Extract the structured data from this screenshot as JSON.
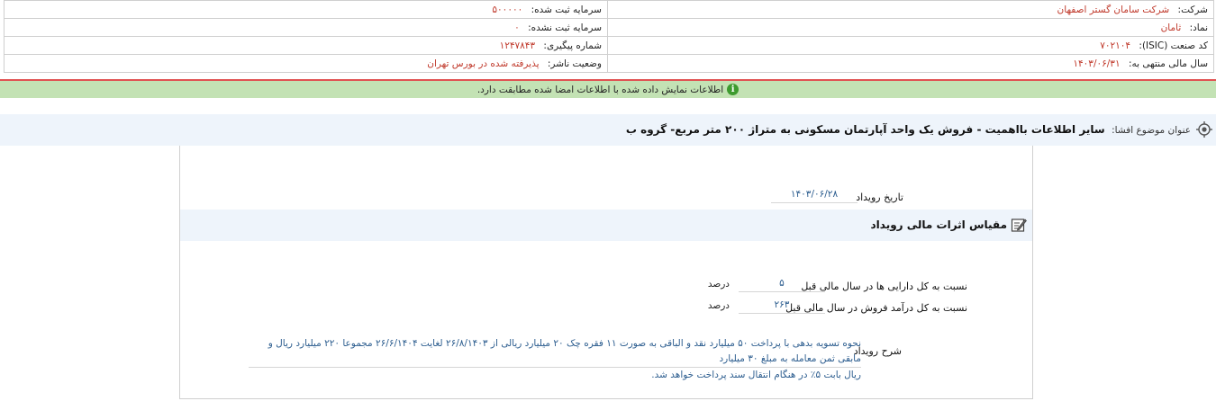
{
  "info": {
    "rows": [
      {
        "right": {
          "label": "شرکت:",
          "value": "شرکت سامان گستر اصفهان"
        },
        "left": {
          "label": "سرمایه ثبت شده:",
          "value": "۵۰۰۰۰۰"
        }
      },
      {
        "right": {
          "label": "نماد:",
          "value": "ثامان"
        },
        "left": {
          "label": "سرمایه ثبت نشده:",
          "value": "۰"
        }
      },
      {
        "right": {
          "label": "کد صنعت (ISIC):",
          "value": "۷۰۲۱۰۴"
        },
        "left": {
          "label": "شماره پیگیری:",
          "value": "۱۲۴۷۸۴۳"
        }
      },
      {
        "right": {
          "label": "سال مالی منتهی به:",
          "value": "۱۴۰۳/۰۶/۳۱"
        },
        "left": {
          "label": "وضعیت ناشر:",
          "value": "پذیرفته شده در بورس تهران"
        }
      }
    ]
  },
  "notice": {
    "icon": "info-icon",
    "text": "اطلاعات نمایش داده شده با اطلاعات امضا شده مطابقت دارد."
  },
  "subject": {
    "label": "عنوان موضوع افشا:",
    "title": "سایر اطلاعات بااهمیت - فروش یک واحد آپارتمان مسکونی به متراژ ۲۰۰ متر مربع- گروه ب"
  },
  "event_date": {
    "label": "تاریخ رویداد",
    "value": "۱۴۰۳/۰۶/۲۸"
  },
  "section": {
    "title": "مقیاس اثرات مالی رویداد"
  },
  "ratios": [
    {
      "label": "نسبت به کل دارایی ها در سال مالی قبل",
      "value": "۵",
      "unit": "درصد"
    },
    {
      "label": "نسبت به کل درآمد فروش در سال مالی قبل",
      "value": "۲۶۳",
      "unit": "درصد"
    }
  ],
  "description": {
    "label": "شرح رویداد",
    "line1": "نحوه تسویه بدهی با پرداخت ۵۰ میلیارد نقد و الباقی به صورت ۱۱ فقره چک ۲۰ میلیارد ریالی از ۲۶/۸/۱۴۰۳ لغایت ۲۶/۶/۱۴۰۴ مجموعا ۲۲۰ میلیارد ریال و مابقی ثمن معامله به مبلغ ۳۰ میلیارد",
    "line2": "ریال بابت ۵٪ در هنگام انتقال سند پرداخت خواهد شد."
  }
}
